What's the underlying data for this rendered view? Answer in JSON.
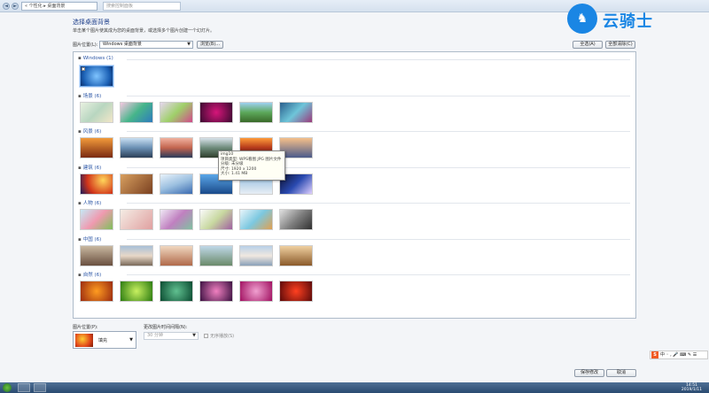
{
  "titlebar": {
    "nav_back": "◄",
    "nav_forward": "►",
    "address": "« 个性化 ▸ 桌面背景",
    "search_placeholder": "搜索控制面板"
  },
  "logo": {
    "text": "云骑士",
    "icon": "knight-icon"
  },
  "page": {
    "title": "选择桌面背景",
    "subtitle": "单击某个图片使其成为您的桌面背景，或选择多个图片创建一个幻灯片。"
  },
  "toolbar": {
    "location_label": "图片位置(L):",
    "location_value": "Windows 桌面背景",
    "browse_label": "浏览(B)...",
    "select_all_label": "全选(A)",
    "clear_all_label": "全部清除(C)"
  },
  "groups": [
    {
      "name": "Windows (1)",
      "thumbs": [
        "win7"
      ]
    },
    {
      "name": "场景 (6)",
      "thumbs": [
        "s1",
        "s2",
        "s3",
        "s4",
        "s5",
        "s6"
      ]
    },
    {
      "name": "风景 (6)",
      "thumbs": [
        "l1",
        "l2",
        "l3",
        "l4",
        "l5",
        "l6"
      ]
    },
    {
      "name": "建筑 (6)",
      "thumbs": [
        "a1",
        "a2",
        "a3",
        "a4",
        "a5",
        "a6"
      ]
    },
    {
      "name": "人物 (6)",
      "thumbs": [
        "c1",
        "c2",
        "c3",
        "c4",
        "c5",
        "c6"
      ]
    },
    {
      "name": "中国 (6)",
      "thumbs": [
        "z1",
        "z2",
        "z3",
        "z4",
        "z5",
        "z6"
      ]
    },
    {
      "name": "自然 (6)",
      "thumbs": [
        "n1",
        "n2",
        "n3",
        "n4",
        "n5",
        "n6"
      ]
    }
  ],
  "tooltip": {
    "name": "img10",
    "type": "项目类型: WPS看图 JPG 图片文件",
    "rating": "分级: 未分级",
    "dims": "尺寸: 1920 x 1200",
    "size": "大小: 1.41 MB"
  },
  "footer": {
    "position_label": "图片位置(P):",
    "position_value": "填充",
    "interval_label": "更改图片时间间隔(N):",
    "interval_value": "30 分钟",
    "shuffle_label": "无序播放(S)",
    "save_label": "保存修改",
    "cancel_label": "取消"
  },
  "ime": {
    "s": "S",
    "label": "中 ◦ , 🎤 ⌨ ✎ ☰"
  },
  "taskbar": {
    "time": "14:51",
    "date": "2019/1/11"
  },
  "colors": {
    "accent": "#1a86e4",
    "link": "#2b56a6"
  }
}
